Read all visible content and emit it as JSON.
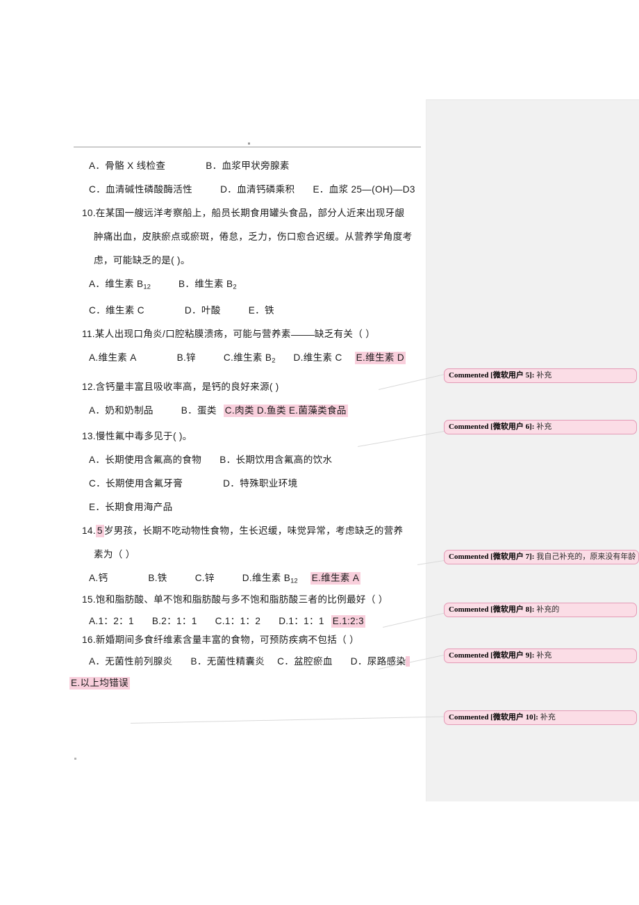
{
  "document": {
    "header_rule": true,
    "questions": [
      {
        "id": "q9-options",
        "lines": [
          {
            "parts": [
              {
                "t": "A．骨骼 X 线检查"
              },
              {
                "space": "xxl"
              },
              {
                "t": "B．血浆甲状旁腺素"
              }
            ]
          },
          {
            "parts": [
              {
                "t": "C．血清碱性磷酸酶活性"
              },
              {
                "space": "xl"
              },
              {
                "t": "D．血清钙磷乘积"
              },
              {
                "space": "l"
              },
              {
                "t": "E．血浆 25—(OH)—D3"
              }
            ]
          }
        ]
      },
      {
        "id": "q10",
        "stem_lines": [
          "10.在某国一艘远洋考察船上，船员长期食用罐头食品，部分人近来出现牙龈",
          "肿痛出血，皮肤瘀点或瘀斑，倦怠，乏力，伤口愈合迟缓。从营养学角度考",
          "虑，可能缺乏的是(    )。"
        ]
      },
      {
        "id": "q10-options",
        "lines": [
          {
            "parts": [
              {
                "t": "A．维生素 B",
                "sub": "12"
              },
              {
                "space": "xl"
              },
              {
                "t": "B．维生素 B",
                "sub": "2"
              }
            ]
          },
          {
            "parts": [
              {
                "t": "C．维生素 C"
              },
              {
                "space": "xxl"
              },
              {
                "t": "D．叶酸"
              },
              {
                "space": "xl"
              },
              {
                "t": "E．铁"
              }
            ]
          }
        ]
      },
      {
        "id": "q11",
        "stem": "11.某人出现口角炎/口腔粘膜溃疡，可能与营养素",
        "stem_tail": "缺乏有关（    ）",
        "options_line": [
          {
            "t": "A.维生素 A"
          },
          {
            "space": "xxl"
          },
          {
            "t": "B.锌"
          },
          {
            "space": "xl"
          },
          {
            "t": "C.维生素 B",
            "sub": "2"
          },
          {
            "space": "l"
          },
          {
            "t": "D.维生素 C"
          },
          {
            "space": "m"
          },
          {
            "t": "E.维生素 D",
            "highlight": true
          }
        ]
      },
      {
        "id": "q12",
        "stem": "12.含钙量丰富且吸收率高，是钙的良好来源(    )",
        "options_line": [
          {
            "t": "A．奶和奶制品"
          },
          {
            "space": "xl"
          },
          {
            "t": "B．蛋类"
          },
          {
            "space": "s"
          },
          {
            "t": "C.肉类   D.鱼类   E.菌藻类食品",
            "highlight": true
          }
        ]
      },
      {
        "id": "q13",
        "stem": "13.慢性氟中毒多见于(    )。",
        "lines": [
          {
            "parts": [
              {
                "t": "A．长期使用含氟高的食物"
              },
              {
                "space": "l"
              },
              {
                "t": "B．长期饮用含氟高的饮水"
              }
            ]
          },
          {
            "parts": [
              {
                "t": "C．长期使用含氟牙膏"
              },
              {
                "space": "xxl"
              },
              {
                "t": "D．特殊职业环境"
              }
            ]
          },
          {
            "parts": [
              {
                "t": "E．长期食用海产品"
              }
            ]
          }
        ]
      },
      {
        "id": "q14",
        "stem_prefix": "14.",
        "stem_highlight": "5",
        "stem_line1": "岁男孩，长期不吃动物性食物，生长迟缓，味觉异常，考虑缺乏的营养",
        "stem_line2": "素为（   ）",
        "options_line": [
          {
            "t": "A.钙"
          },
          {
            "space": "xxl"
          },
          {
            "t": "B.铁"
          },
          {
            "space": "xl"
          },
          {
            "t": "C.锌"
          },
          {
            "space": "xl"
          },
          {
            "t": "D.维生素 B",
            "sub": "12"
          },
          {
            "space": "m"
          },
          {
            "t": "E.维生素 A",
            "highlight": true
          }
        ]
      },
      {
        "id": "q15",
        "stem": "15.饱和脂肪酸、单不饱和脂肪酸与多不饱和脂肪酸三者的比例最好（   ）",
        "options_line": [
          {
            "t": "A.1：2：1"
          },
          {
            "space": "l"
          },
          {
            "t": "B.2：1：1"
          },
          {
            "space": "l"
          },
          {
            "t": "C.1：1：2"
          },
          {
            "space": "l"
          },
          {
            "t": "D.1：1：1"
          },
          {
            "space": "s"
          },
          {
            "t": "E.1:2:3",
            "highlight": true
          }
        ]
      },
      {
        "id": "q16",
        "stem": "16.新婚期间多食纤维素含量丰富的食物，可预防疾病不包括（    ）",
        "options_line": [
          {
            "t": "A．无菌性前列腺炎"
          },
          {
            "space": "l"
          },
          {
            "t": "B．无菌性精囊炎"
          },
          {
            "space": "m"
          },
          {
            "t": "C．盆腔瘀血"
          },
          {
            "space": "l"
          },
          {
            "t": "D．尿路感染"
          }
        ],
        "overflow_line": {
          "t": "E.以上均错误",
          "highlight": true
        }
      }
    ]
  },
  "comments": [
    {
      "id": "c5",
      "label": "Commented [微软用户 5]:",
      "text": "补充"
    },
    {
      "id": "c6",
      "label": "Commented [微软用户 6]:",
      "text": "补充"
    },
    {
      "id": "c7",
      "label": "Commented [微软用户 7]:",
      "text": "我自己补充的，原来没有年龄"
    },
    {
      "id": "c8",
      "label": "Commented [微软用户 8]:",
      "text": "补充的"
    },
    {
      "id": "c9",
      "label": "Commented [微软用户 9]:",
      "text": "补充"
    },
    {
      "id": "c10",
      "label": "Commented [微软用户 10]:",
      "text": "补充"
    }
  ],
  "colors": {
    "highlight": "#f9cfdc",
    "comment_fill": "#fbdde6",
    "comment_border": "#e49ab6",
    "margin_panel": "#f1f1f1",
    "rule": "#9c9c9c"
  }
}
